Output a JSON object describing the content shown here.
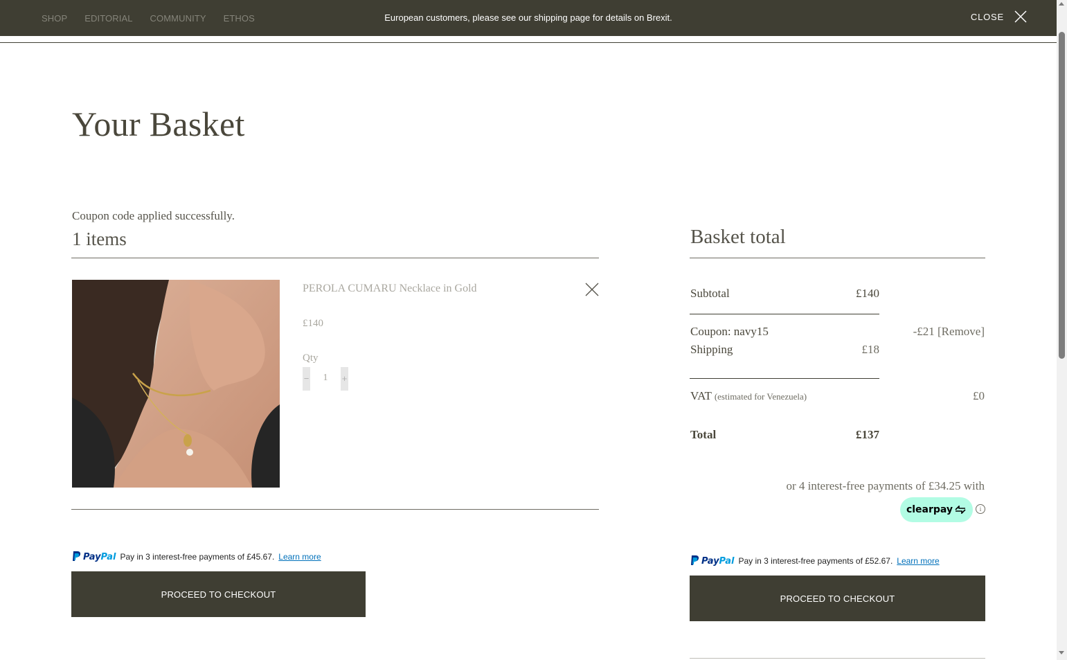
{
  "nav": {
    "items": [
      "SHOP",
      "EDITORIAL",
      "COMMUNITY",
      "ETHOS"
    ]
  },
  "banner": {
    "message": "European customers, please see our shipping page for details on Brexit.",
    "close_label": "CLOSE"
  },
  "page": {
    "title": "Your Basket",
    "coupon_message": "Coupon code applied successfully.",
    "items_count": "1 items"
  },
  "product": {
    "name": "PEROLA CUMARU Necklace in Gold",
    "price": "£140",
    "qty_label": "Qty",
    "qty_value": "1",
    "minus": "−",
    "plus": "+"
  },
  "paypal_left": {
    "brand_a": "Pay",
    "brand_b": "Pal",
    "text": "Pay in 3 interest-free payments of £45.67.",
    "link": "Learn more"
  },
  "paypal_right": {
    "brand_a": "Pay",
    "brand_b": "Pal",
    "text": "Pay in 3 interest-free payments of £52.67.",
    "link": "Learn more"
  },
  "checkout": {
    "label": "PROCEED TO CHECKOUT"
  },
  "totals": {
    "title": "Basket total",
    "subtotal_label": "Subtotal",
    "subtotal_value": "£140",
    "coupon_label": "Coupon: navy15",
    "coupon_value": "-£21 [Remove]",
    "shipping_label": "Shipping",
    "shipping_value": "£18",
    "vat_label": "VAT",
    "vat_note": "(estimated for Venezuela)",
    "vat_value": "£0",
    "total_label": "Total",
    "total_value": "£137"
  },
  "clearpay": {
    "text": "or 4 interest-free payments of £34.25 with",
    "badge": "clearpay",
    "info": "i"
  },
  "colors": {
    "dark": "#3f3e33",
    "clearpay_mint": "#b2fce4",
    "paypal_navy": "#003087",
    "paypal_blue": "#009cde"
  }
}
